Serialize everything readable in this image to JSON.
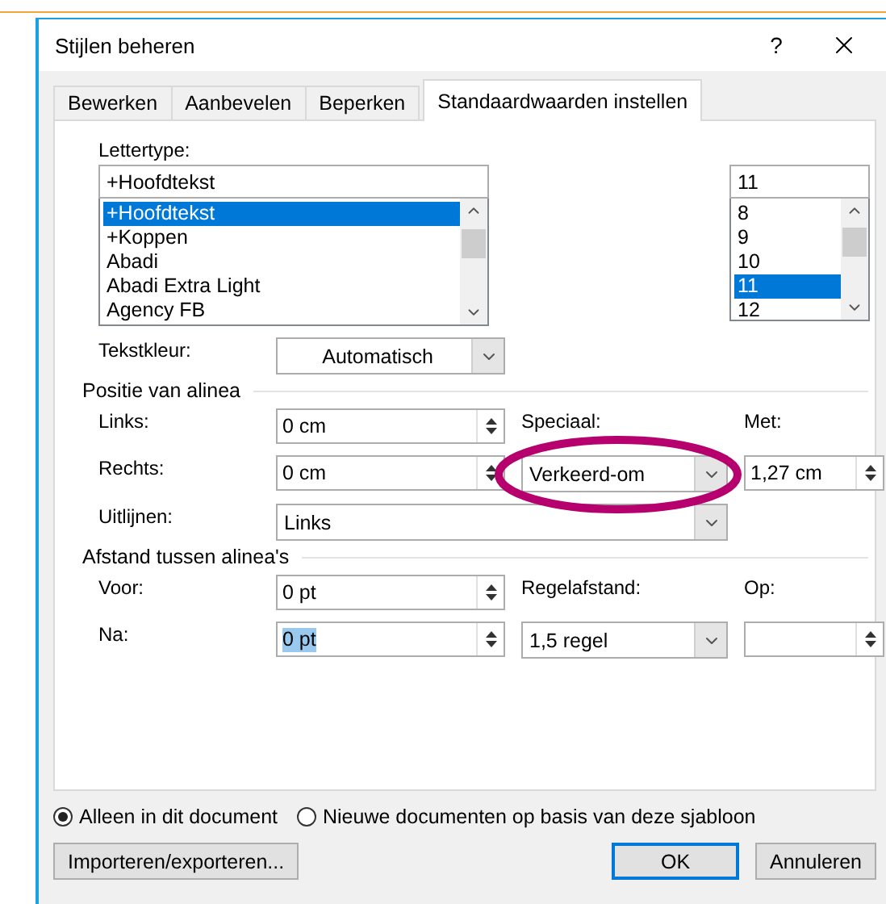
{
  "window": {
    "title": "Stijlen beheren",
    "help": "?"
  },
  "tabs": [
    {
      "label": "Bewerken",
      "selected": false
    },
    {
      "label": "Aanbevelen",
      "selected": false
    },
    {
      "label": "Beperken",
      "selected": false
    },
    {
      "label": "Standaardwaarden instellen",
      "selected": true
    }
  ],
  "font": {
    "label": "Lettertype:",
    "value": "+Hoofdtekst",
    "options": [
      {
        "label": "+Hoofdtekst",
        "selected": true
      },
      {
        "label": "+Koppen",
        "selected": false
      },
      {
        "label": "Abadi",
        "selected": false
      },
      {
        "label": "Abadi Extra Light",
        "selected": false
      },
      {
        "label": "Agency FB",
        "selected": false
      }
    ]
  },
  "size": {
    "value": "11",
    "options": [
      {
        "label": "8",
        "selected": false
      },
      {
        "label": "9",
        "selected": false
      },
      {
        "label": "10",
        "selected": false
      },
      {
        "label": "11",
        "selected": true
      },
      {
        "label": "12",
        "selected": false
      }
    ]
  },
  "text_color": {
    "label": "Tekstkleur:",
    "value": "Automatisch"
  },
  "sections": [
    {
      "title": "Positie van alinea",
      "rows": [
        [
          {
            "kind": "label",
            "text": "Links:"
          },
          {
            "kind": "spin",
            "value": "0 cm",
            "highlighted": false
          },
          {
            "kind": "label",
            "text": "Speciaal:"
          },
          {
            "kind": "label",
            "text": "Met:"
          }
        ],
        [
          {
            "kind": "label",
            "text": "Rechts:"
          },
          {
            "kind": "spin",
            "value": "0 cm",
            "highlighted": false
          },
          {
            "kind": "combo",
            "value": "Verkeerd-om",
            "circled": true
          },
          {
            "kind": "spin",
            "value": "1,27 cm",
            "highlighted": false
          }
        ],
        [
          {
            "kind": "label",
            "text": "Uitlijnen:"
          },
          {
            "kind": "wide_combo",
            "value": "Links"
          }
        ]
      ]
    },
    {
      "title": "Afstand tussen alinea's",
      "rows": [
        [
          {
            "kind": "label",
            "text": "Voor:"
          },
          {
            "kind": "spin",
            "value": "0 pt",
            "highlighted": false
          },
          {
            "kind": "label",
            "text": "Regelafstand:"
          },
          {
            "kind": "label",
            "text": "Op:"
          }
        ],
        [
          {
            "kind": "label",
            "text": "Na:"
          },
          {
            "kind": "spin",
            "value": "0 pt",
            "highlighted": true
          },
          {
            "kind": "combo",
            "value": "1,5 regel",
            "circled": false
          },
          {
            "kind": "spin"
          }
        ]
      ]
    }
  ],
  "scope": [
    {
      "label": "Alleen in dit document",
      "selected": true
    },
    {
      "label": "Nieuwe documenten op basis van deze sjabloon",
      "selected": false
    }
  ],
  "buttons": [
    {
      "label": "Importeren/exporteren...",
      "default": false
    },
    {
      "label": "OK",
      "default": true
    },
    {
      "label": "Annuleren",
      "default": false
    }
  ]
}
